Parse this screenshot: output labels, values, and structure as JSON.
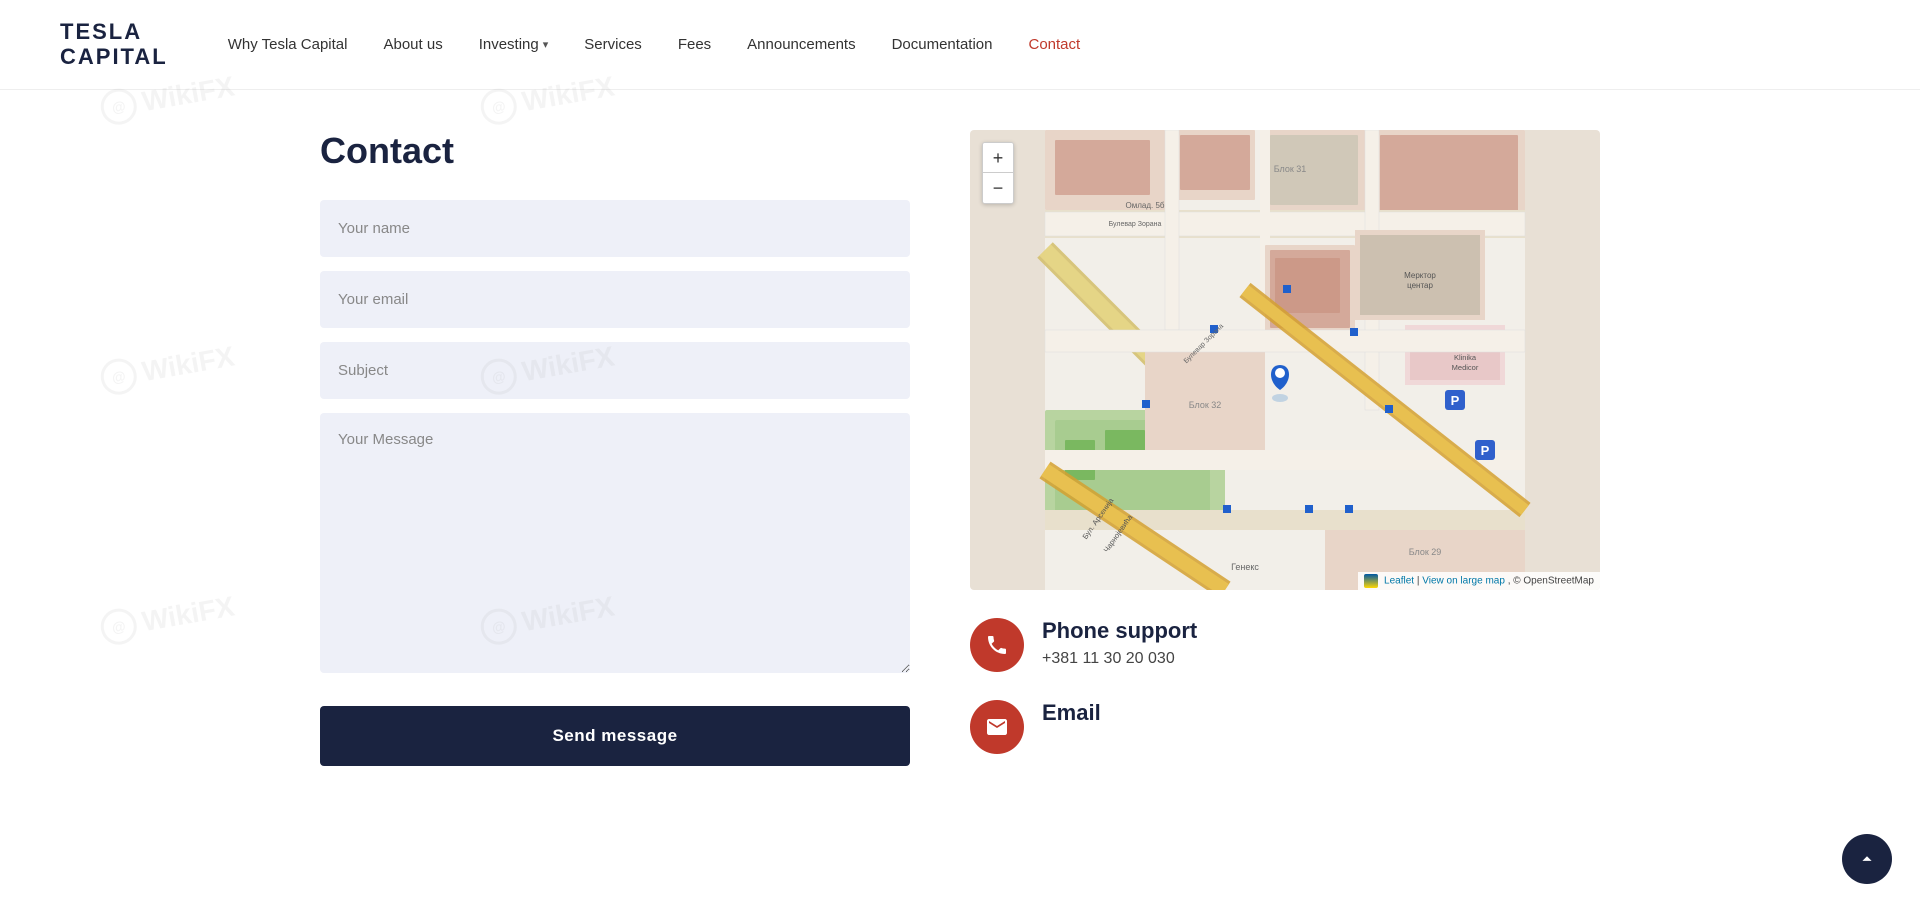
{
  "brand": {
    "name_line1": "TESLA",
    "name_line2": "CAPITAL",
    "square_color": "#b22222"
  },
  "nav": {
    "links": [
      {
        "id": "why-tesla",
        "label": "Why Tesla Capital",
        "active": false
      },
      {
        "id": "about-us",
        "label": "About us",
        "active": false
      },
      {
        "id": "investing",
        "label": "Investing",
        "active": false,
        "hasDropdown": true
      },
      {
        "id": "services",
        "label": "Services",
        "active": false
      },
      {
        "id": "fees",
        "label": "Fees",
        "active": false
      },
      {
        "id": "announcements",
        "label": "Announcements",
        "active": false
      },
      {
        "id": "documentation",
        "label": "Documentation",
        "active": false
      },
      {
        "id": "contact",
        "label": "Contact",
        "active": true
      }
    ]
  },
  "page": {
    "title": "Contact"
  },
  "form": {
    "name_placeholder": "Your name",
    "email_placeholder": "Your email",
    "subject_placeholder": "Subject",
    "message_placeholder": "Your Message",
    "send_button": "Send message"
  },
  "map": {
    "zoom_in": "+",
    "zoom_out": "−",
    "attribution_leaflet": "Leaflet",
    "attribution_view": "View on large map",
    "attribution_osm": "© OpenStreetMap"
  },
  "contact_info": [
    {
      "id": "phone",
      "title": "Phone support",
      "value": "+381 11 30 20 030",
      "icon": "phone"
    },
    {
      "id": "email",
      "title": "Email",
      "value": "",
      "icon": "email"
    }
  ],
  "scroll_top": {
    "label": "Scroll to top"
  }
}
